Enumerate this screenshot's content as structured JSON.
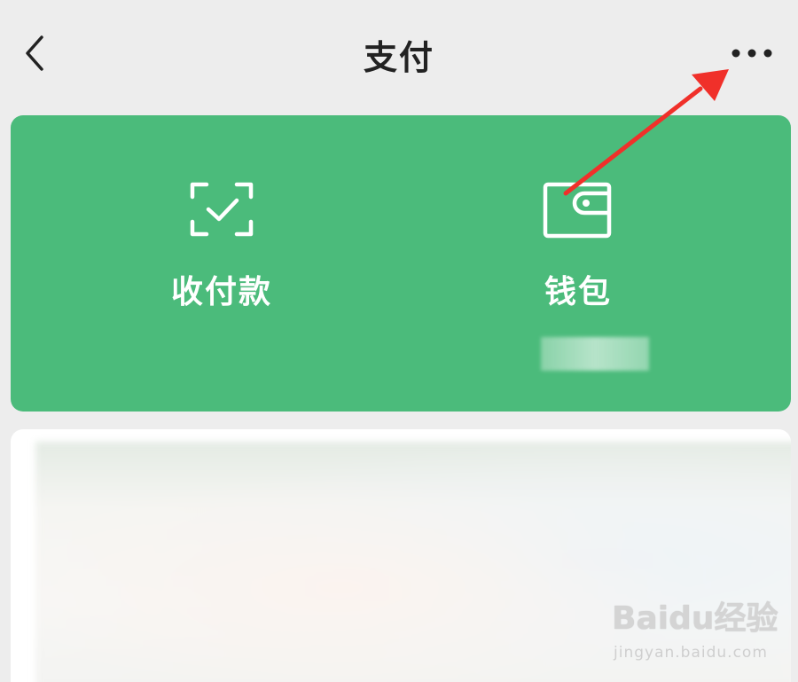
{
  "header": {
    "title": "支付",
    "back_icon": "chevron-left-icon",
    "more_icon": "more-dots-icon"
  },
  "card": {
    "background_color": "#4bbb7b",
    "items": [
      {
        "label": "收付款",
        "icon": "scan-check-icon"
      },
      {
        "label": "钱包",
        "icon": "wallet-icon"
      }
    ]
  },
  "annotation": {
    "arrow_color": "#f0302a"
  },
  "watermark": {
    "brand": "Baidu经验",
    "url": "jingyan.baidu.com"
  }
}
